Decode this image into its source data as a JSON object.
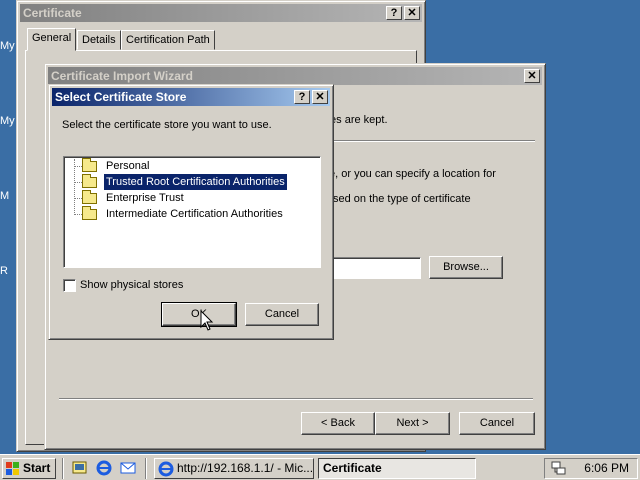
{
  "desktop": {
    "labels": [
      "My",
      "My",
      "M",
      "R"
    ]
  },
  "cert_window": {
    "title": "Certificate",
    "help_btn": "?",
    "close_btn": "✕",
    "tabs": [
      {
        "label": "General",
        "selected": true
      },
      {
        "label": "Details",
        "selected": false
      },
      {
        "label": "Certification Path",
        "selected": false
      }
    ]
  },
  "wizard": {
    "title": "Certificate Import Wizard",
    "close_btn": "✕",
    "partial_texts": [
      "tes are kept.",
      "e, or you can specify a location for",
      "sed on the type of certificate"
    ],
    "browse_label": "Browse...",
    "back_label": "< Back",
    "next_label": "Next >",
    "cancel_label": "Cancel"
  },
  "store_dialog": {
    "title": "Select Certificate Store",
    "help_btn": "?",
    "close_btn": "✕",
    "instruction": "Select the certificate store you want to use.",
    "stores": [
      {
        "label": "Personal",
        "selected": false
      },
      {
        "label": "Trusted Root Certification Authorities",
        "selected": true
      },
      {
        "label": "Enterprise Trust",
        "selected": false
      },
      {
        "label": "Intermediate Certification Authorities",
        "selected": false
      }
    ],
    "show_physical_label": "Show physical stores",
    "show_physical_checked": false,
    "ok_label": "OK",
    "cancel_label": "Cancel"
  },
  "taskbar": {
    "start_label": "Start",
    "tasks": [
      {
        "label": "http://192.168.1.1/ - Mic...",
        "pressed": false
      },
      {
        "label": "Certificate",
        "pressed": true
      }
    ],
    "clock": "6:06 PM"
  },
  "colors": {
    "desktop": "#3a6ea5",
    "active_title": "#0a246a",
    "face": "#d4d0c8",
    "selection": "#0a246a"
  }
}
